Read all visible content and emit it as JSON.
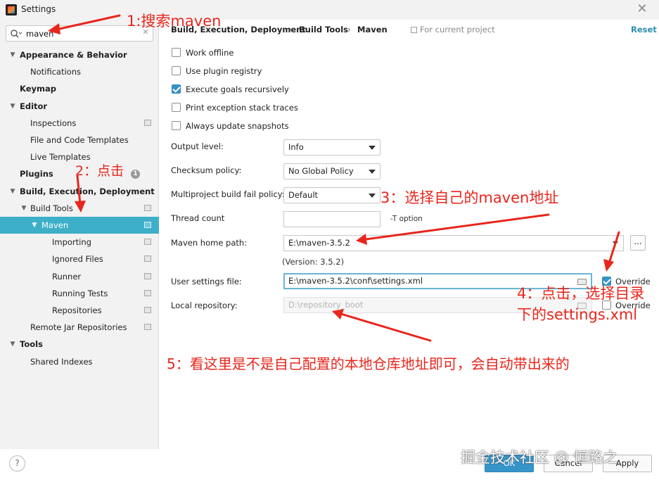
{
  "window": {
    "title": "Settings",
    "close_glyph": "✕"
  },
  "search": {
    "value": "maven",
    "placeholder": "",
    "icon": "search-icon",
    "clear_glyph": "✕"
  },
  "sidebar": {
    "items": [
      {
        "label": "Appearance & Behavior",
        "level": 0,
        "bold": true,
        "arrow": "▼"
      },
      {
        "label": "Notifications",
        "level": 1
      },
      {
        "label": "Keymap",
        "level": 0,
        "bold": true
      },
      {
        "label": "Editor",
        "level": 0,
        "bold": true,
        "arrow": "▼"
      },
      {
        "label": "Inspections",
        "level": 1
      },
      {
        "label": "File and Code Templates",
        "level": 1
      },
      {
        "label": "Live Templates",
        "level": 1
      },
      {
        "label": "Plugins",
        "level": 0,
        "bold": true,
        "badge": "1"
      },
      {
        "label": "Build, Execution, Deployment",
        "level": 0,
        "bold": true,
        "arrow": "▼"
      },
      {
        "label": "Build Tools",
        "level": 1,
        "arrow": "▼"
      },
      {
        "label": "Maven",
        "level": 2,
        "arrow": "▼",
        "selected": true
      },
      {
        "label": "Importing",
        "level": 3
      },
      {
        "label": "Ignored Files",
        "level": 3
      },
      {
        "label": "Runner",
        "level": 3
      },
      {
        "label": "Running Tests",
        "level": 3
      },
      {
        "label": "Repositories",
        "level": 3
      },
      {
        "label": "Remote Jar Repositories",
        "level": 1
      },
      {
        "label": "Tools",
        "level": 0,
        "bold": true,
        "arrow": "▼"
      },
      {
        "label": "Shared Indexes",
        "level": 1
      }
    ]
  },
  "breadcrumb": {
    "items": [
      "Build, Execution, Deployment",
      "Build Tools",
      "Maven"
    ],
    "separator": "›"
  },
  "for_project": "For current project",
  "reset": "Reset",
  "checkboxes": [
    {
      "label": "Work offline",
      "checked": false
    },
    {
      "label": "Use plugin registry",
      "checked": false
    },
    {
      "label": "Execute goals recursively",
      "checked": true
    },
    {
      "label": "Print exception stack traces",
      "checked": false
    },
    {
      "label": "Always update snapshots",
      "checked": false
    }
  ],
  "form": {
    "output_level": {
      "label": "Output level:",
      "value": "Info"
    },
    "checksum_policy": {
      "label": "Checksum policy:",
      "value": "No Global Policy"
    },
    "multiproject_policy": {
      "label": "Multiproject build fail policy:",
      "value": "Default"
    },
    "thread_count": {
      "label": "Thread count",
      "value": "",
      "note": "-T option"
    },
    "maven_home": {
      "label": "Maven home path:",
      "value": "E:\\maven-3.5.2",
      "version": "(Version: 3.5.2)",
      "browse": "..."
    },
    "user_settings": {
      "label": "User settings file:",
      "value": "E:\\maven-3.5.2\\conf\\settings.xml",
      "override": "Override",
      "override_checked": true
    },
    "local_repo": {
      "label": "Local repository:",
      "value": "D:\\repository_boot",
      "override": "Override",
      "override_checked": false
    }
  },
  "buttons": {
    "ok": "OK",
    "cancel": "Cancel",
    "apply": "Apply",
    "help": "?"
  },
  "annotations": {
    "a1": "1:搜索maven",
    "a2": "2：点击",
    "a3": "3：选择自己的maven地址",
    "a4_line1": "4：点击，选择目录",
    "a4_line2": "下的settings.xml",
    "a5": "5：看这里是不是自己配置的本地仓库地址即可，会自动带出来的",
    "color": "#e8261c"
  },
  "watermark": "掘金技术社区 @ 恒路之",
  "colors": {
    "selection": "#3dafc9",
    "accent": "#3794c9",
    "reset_link": "#2a8fb0"
  }
}
